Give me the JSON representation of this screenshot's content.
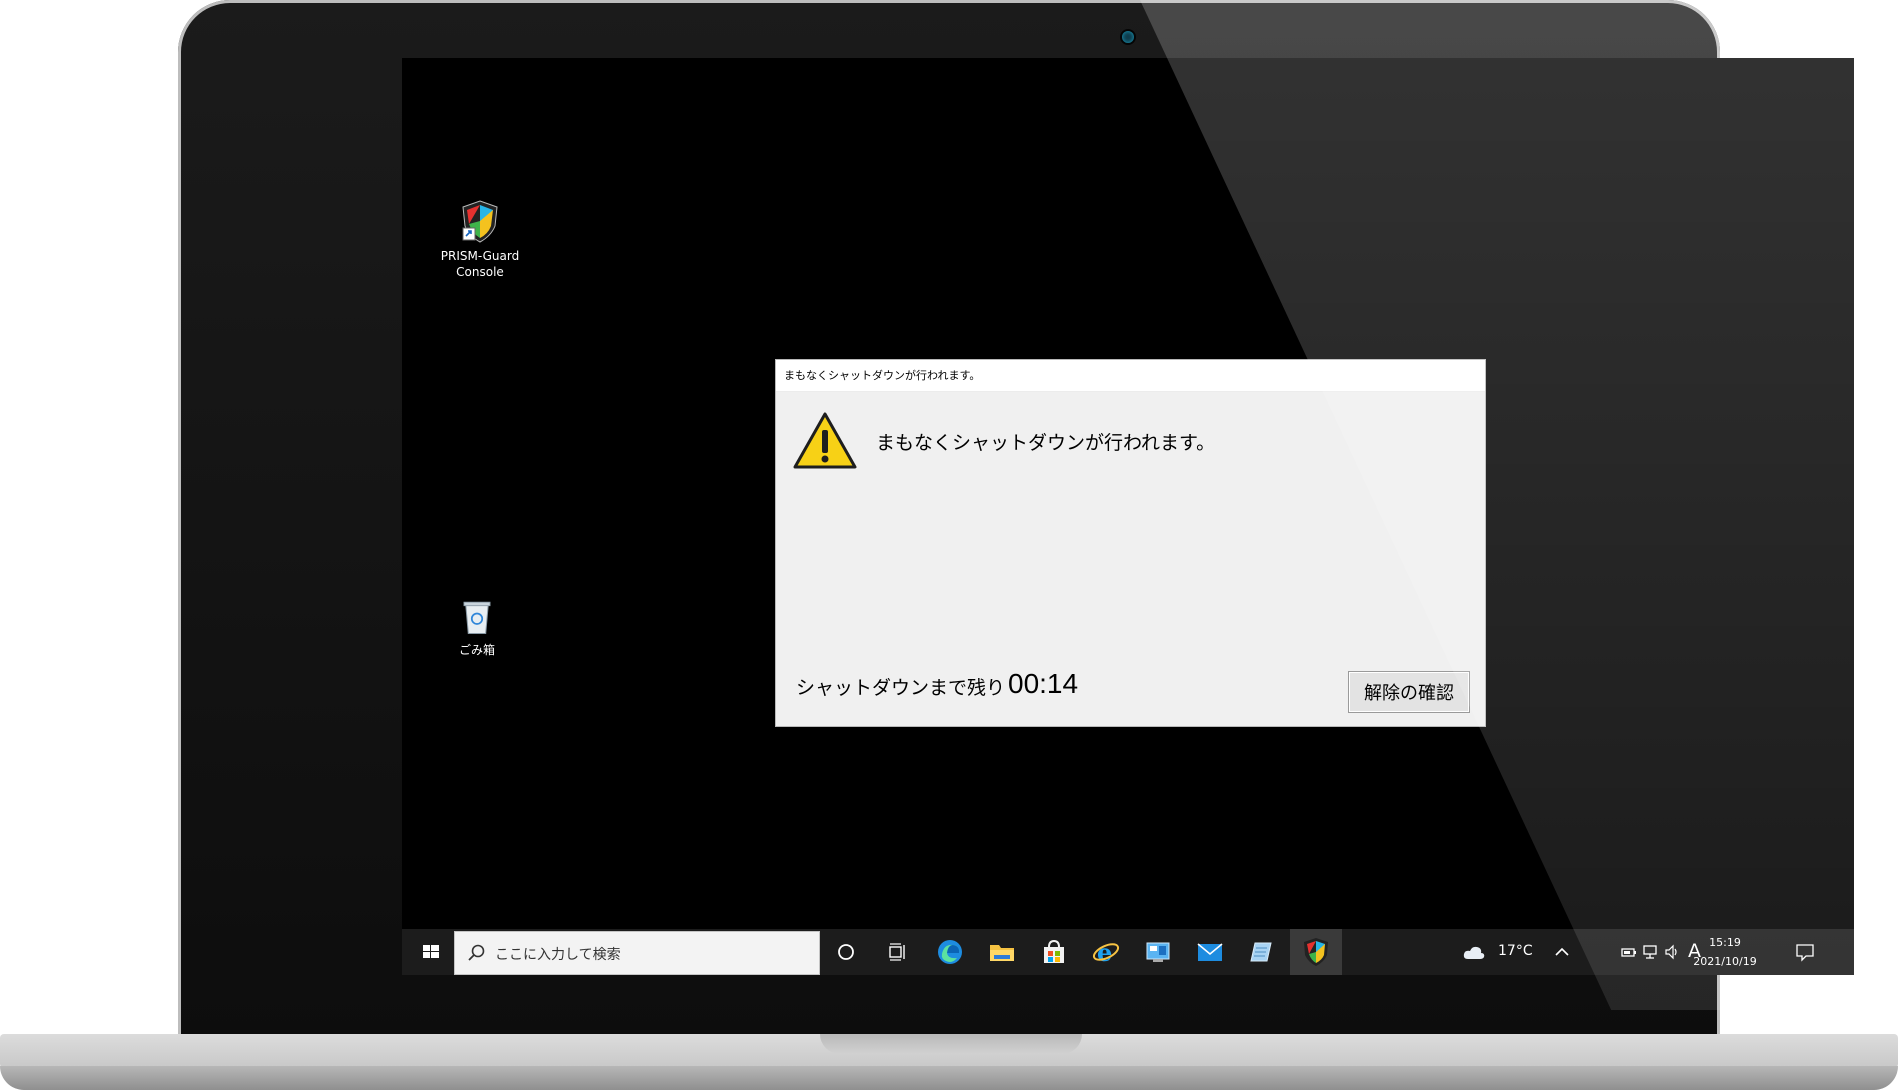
{
  "desktop": {
    "icons": [
      {
        "label_line1": "PRISM-Guard",
        "label_line2": "Console"
      },
      {
        "label_line1": "ごみ箱"
      }
    ]
  },
  "dialog": {
    "title": "まもなくシャットダウンが行われます。",
    "message": "まもなくシャットダウンが行われます。",
    "remaining_label": "シャットダウンまで残り",
    "countdown": "00:14",
    "confirm_button": "解除の確認"
  },
  "taskbar": {
    "search_placeholder": "ここに入力して検索",
    "weather": "17°C",
    "ime": "A",
    "time": "15:19",
    "date": "2021/10/19"
  },
  "icons": {
    "start": "windows-start-icon",
    "search": "search-icon",
    "cortana": "cortana-icon",
    "task_view": "task-view-icon",
    "edge": "edge-icon",
    "explorer": "file-explorer-icon",
    "store": "store-icon",
    "ie": "internet-explorer-icon",
    "controlpanel": "control-panel-icon",
    "mail": "mail-icon",
    "notepad": "notepad-icon",
    "prism": "prism-guard-icon",
    "weather": "cloud-icon",
    "chevron": "chevron-up-icon",
    "battery": "battery-icon",
    "network": "network-icon",
    "volume": "volume-icon",
    "notification": "notification-icon"
  },
  "colors": {
    "warning_yellow": "#f7d116",
    "edge_blue": "#1d8ce0",
    "folder_yellow": "#f5c242"
  }
}
